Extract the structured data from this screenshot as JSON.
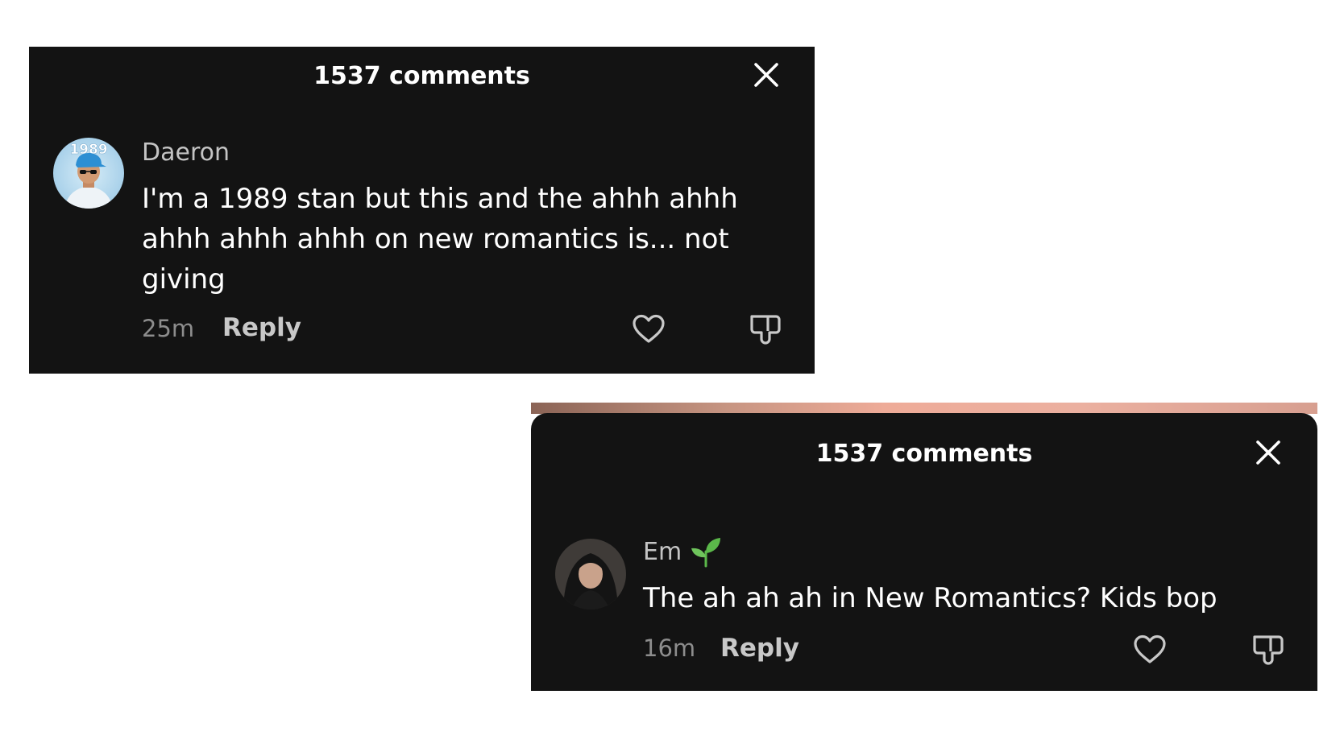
{
  "comments": [
    {
      "header": "1537 comments",
      "username": "Daeron",
      "text_lines": [
        "I'm a 1989 stan but this and the ahhh ahhh",
        "ahhh ahhh ahhh on new romantics is... not",
        "giving"
      ],
      "timestamp": "25m",
      "reply_label": "Reply",
      "avatar_text": "1989"
    },
    {
      "header": "1537 comments",
      "username": "Em",
      "username_emoji": "seedling-icon",
      "text_lines": [
        "The ah ah ah in New Romantics? Kids bop"
      ],
      "timestamp": "16m",
      "reply_label": "Reply"
    }
  ],
  "colors": {
    "panel_bg": "#131313",
    "username": "#c4c4c4",
    "timestamp": "#8d8d8d",
    "reply": "#c8c8c8",
    "seedling": "#5bb84a"
  }
}
